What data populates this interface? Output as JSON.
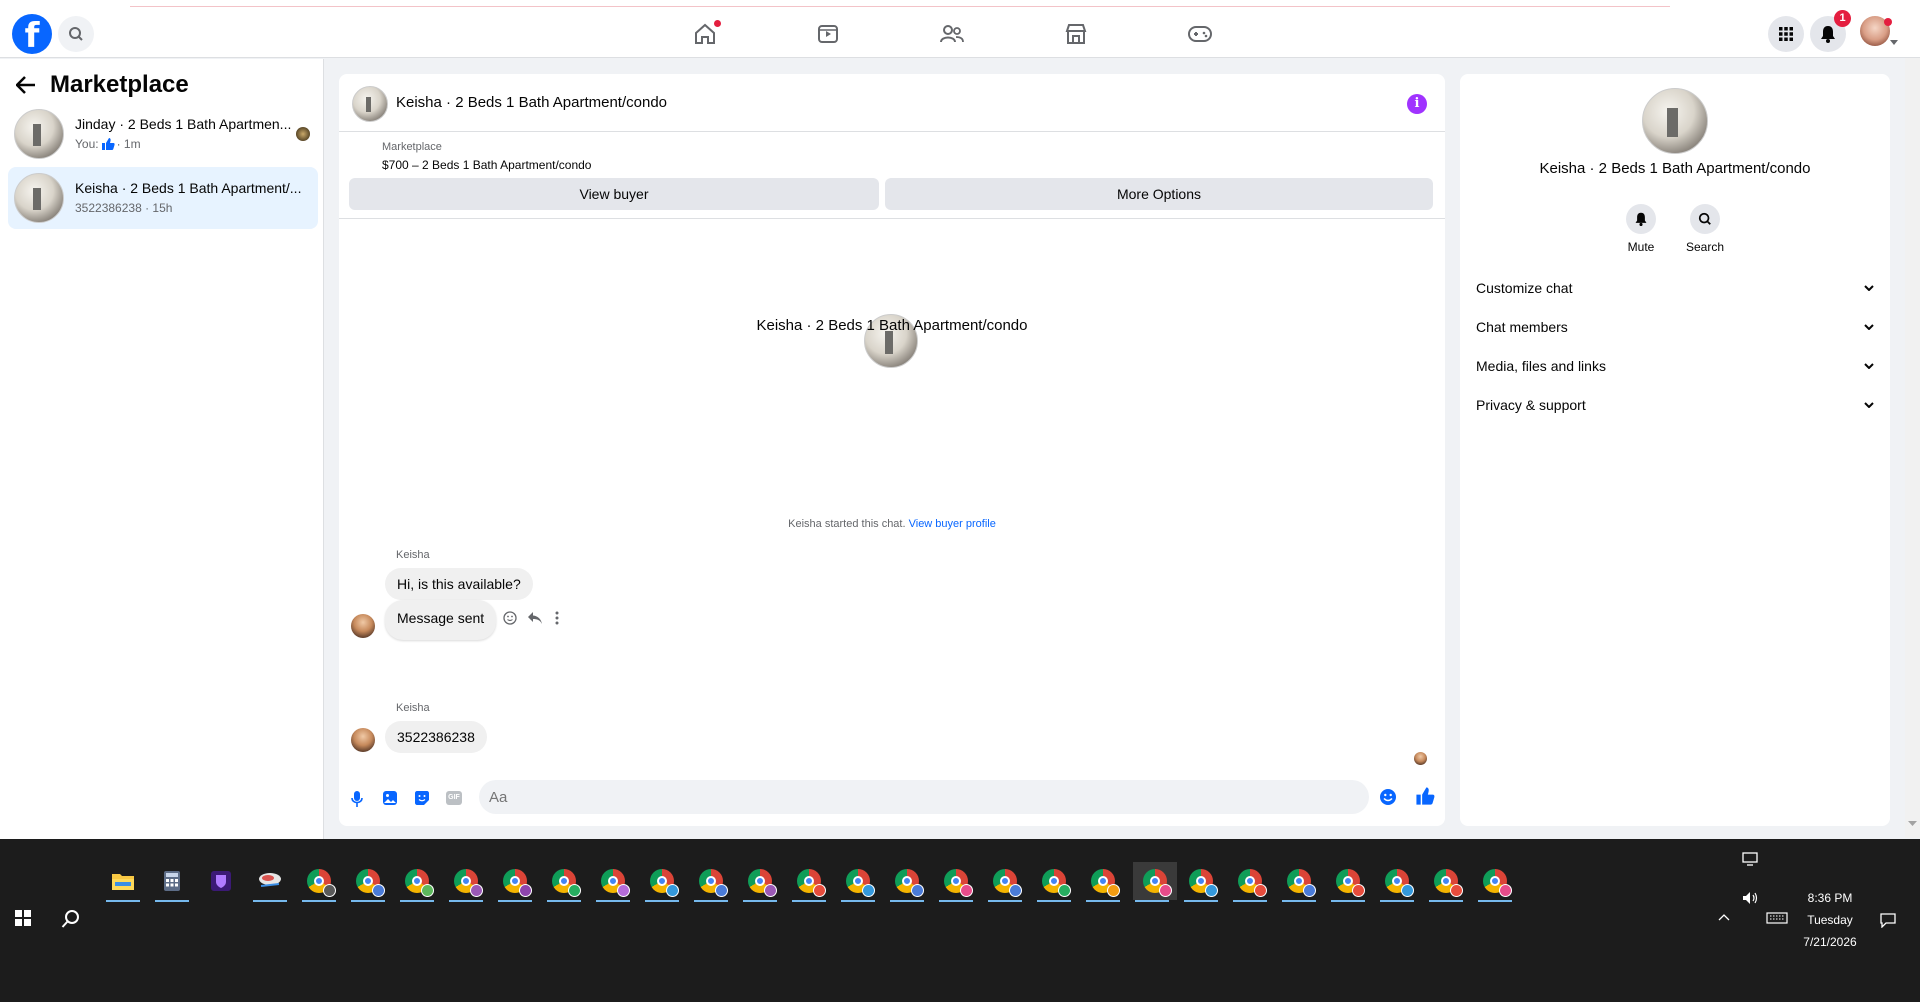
{
  "topbar": {
    "logo": "f",
    "icons": [
      "search-icon",
      "home-icon",
      "video-icon",
      "friends-icon",
      "marketplace-icon",
      "gaming-icon",
      "menu-grid-icon",
      "bell-icon"
    ],
    "notification_count": "1"
  },
  "left": {
    "title": "Marketplace",
    "conversations": [
      {
        "title": "Jinday · 2 Beds 1 Bath Apartmen...",
        "sub_prefix": "You:",
        "sub_suffix": "· 1m"
      },
      {
        "title": "Keisha · 2 Beds 1 Bath Apartment/...",
        "sub": "3522386238 · 15h"
      }
    ]
  },
  "chat": {
    "header_title": "Keisha · 2 Beds 1 Bath Apartment/condo",
    "listing_label": "Marketplace",
    "listing_text": "$700 – 2 Beds 1 Bath Apartment/condo",
    "view_buyer": "View buyer",
    "more_options": "More Options",
    "center_title": "Keisha · 2 Beds 1 Bath Apartment/condo",
    "started_text": "Keisha started this chat.",
    "started_link": "View buyer profile",
    "messages": [
      {
        "sender": "Keisha",
        "text": "Hi, is this available?"
      },
      {
        "text": "Message sent"
      },
      {
        "sender": "Keisha",
        "text": "3522386238"
      }
    ],
    "composer_placeholder": "Aa"
  },
  "info": {
    "title": "Keisha · 2 Beds 1 Bath Apartment/condo",
    "actions": [
      "Mute",
      "Search"
    ],
    "sections": [
      "Customize chat",
      "Chat members",
      "Media, files and links",
      "Privacy & support"
    ]
  },
  "taskbar": {
    "time": "8:36 PM",
    "day": "Tuesday",
    "date": "7/21/2026"
  },
  "colors": {
    "accent": "#0866ff",
    "active_conv": "#e7f3ff",
    "info_purple": "#a033ff",
    "notification": "#e41e3f"
  }
}
